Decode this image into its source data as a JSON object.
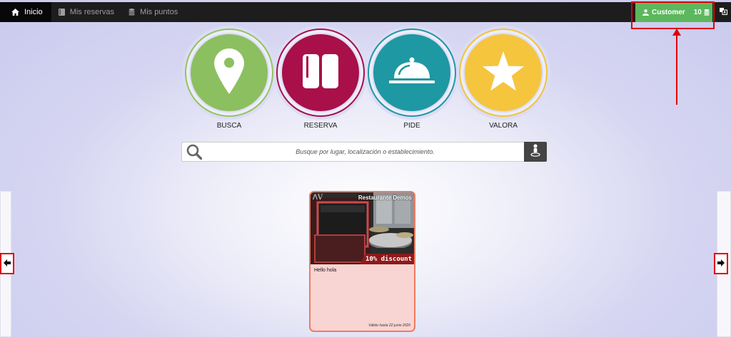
{
  "nav": {
    "items": [
      {
        "label": "Inicio",
        "icon": "home-icon",
        "active": true
      },
      {
        "label": "Mis reservas",
        "icon": "book-icon",
        "active": false
      },
      {
        "label": "Mis puntos",
        "icon": "coins-icon",
        "active": false
      }
    ],
    "customer_label": "Customer",
    "points": "10",
    "customer_color": "#5cb85c"
  },
  "actions": [
    {
      "label": "BUSCA",
      "icon": "map-pin-icon",
      "color": "#8cbf5f",
      "ring": "#93c55f"
    },
    {
      "label": "RESERVA",
      "icon": "book-icon",
      "color": "#a90f48",
      "ring": "#a90f48"
    },
    {
      "label": "PIDE",
      "icon": "cloche-icon",
      "color": "#1e98a3",
      "ring": "#1e98a3"
    },
    {
      "label": "VALORA",
      "icon": "star-icon",
      "color": "#f5c53e",
      "ring": "#f0c43c"
    }
  ],
  "search": {
    "placeholder": "Busque por lugar, localización o establecimiento."
  },
  "card": {
    "title": "Restaurante Demos",
    "logo": "ⴷV",
    "discount": "10% discount",
    "description": "Hello hola",
    "valid": "Válido hasta 22 junio 2026",
    "bg_color": "#f8d5d2",
    "border_color": "#ef7b63"
  }
}
